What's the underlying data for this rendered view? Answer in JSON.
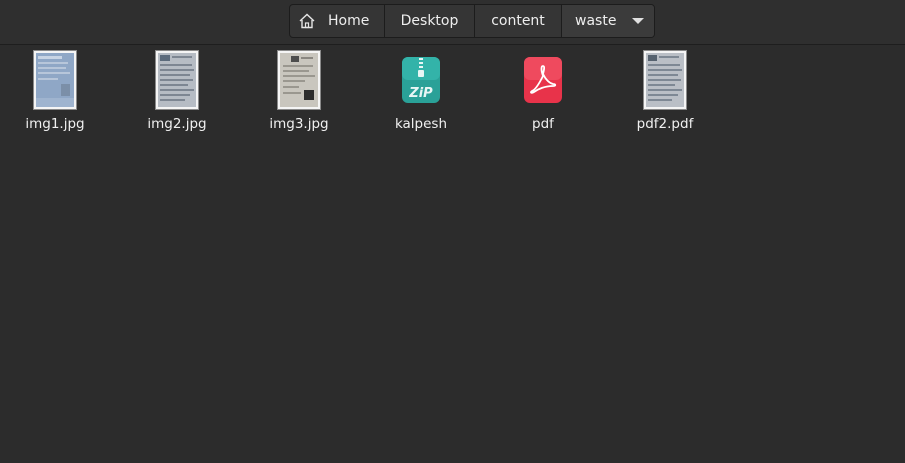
{
  "breadcrumb": {
    "items": [
      {
        "label": "Home",
        "icon": "home-icon"
      },
      {
        "label": "Desktop"
      },
      {
        "label": "content"
      },
      {
        "label": "waste",
        "icon": "chevron-down-icon"
      }
    ]
  },
  "files": [
    {
      "name": "img1.jpg",
      "icon": "image-thumbnail-icon"
    },
    {
      "name": "img2.jpg",
      "icon": "image-thumbnail-icon"
    },
    {
      "name": "img3.jpg",
      "icon": "image-thumbnail-icon"
    },
    {
      "name": "kalpesh",
      "icon": "zip-archive-icon"
    },
    {
      "name": "pdf",
      "icon": "pdf-icon"
    },
    {
      "name": "pdf2.pdf",
      "icon": "document-thumbnail-icon"
    }
  ],
  "colors": {
    "background": "#2c2c2c",
    "zip_accent": "#2aa198",
    "pdf_accent": "#e8334a"
  }
}
